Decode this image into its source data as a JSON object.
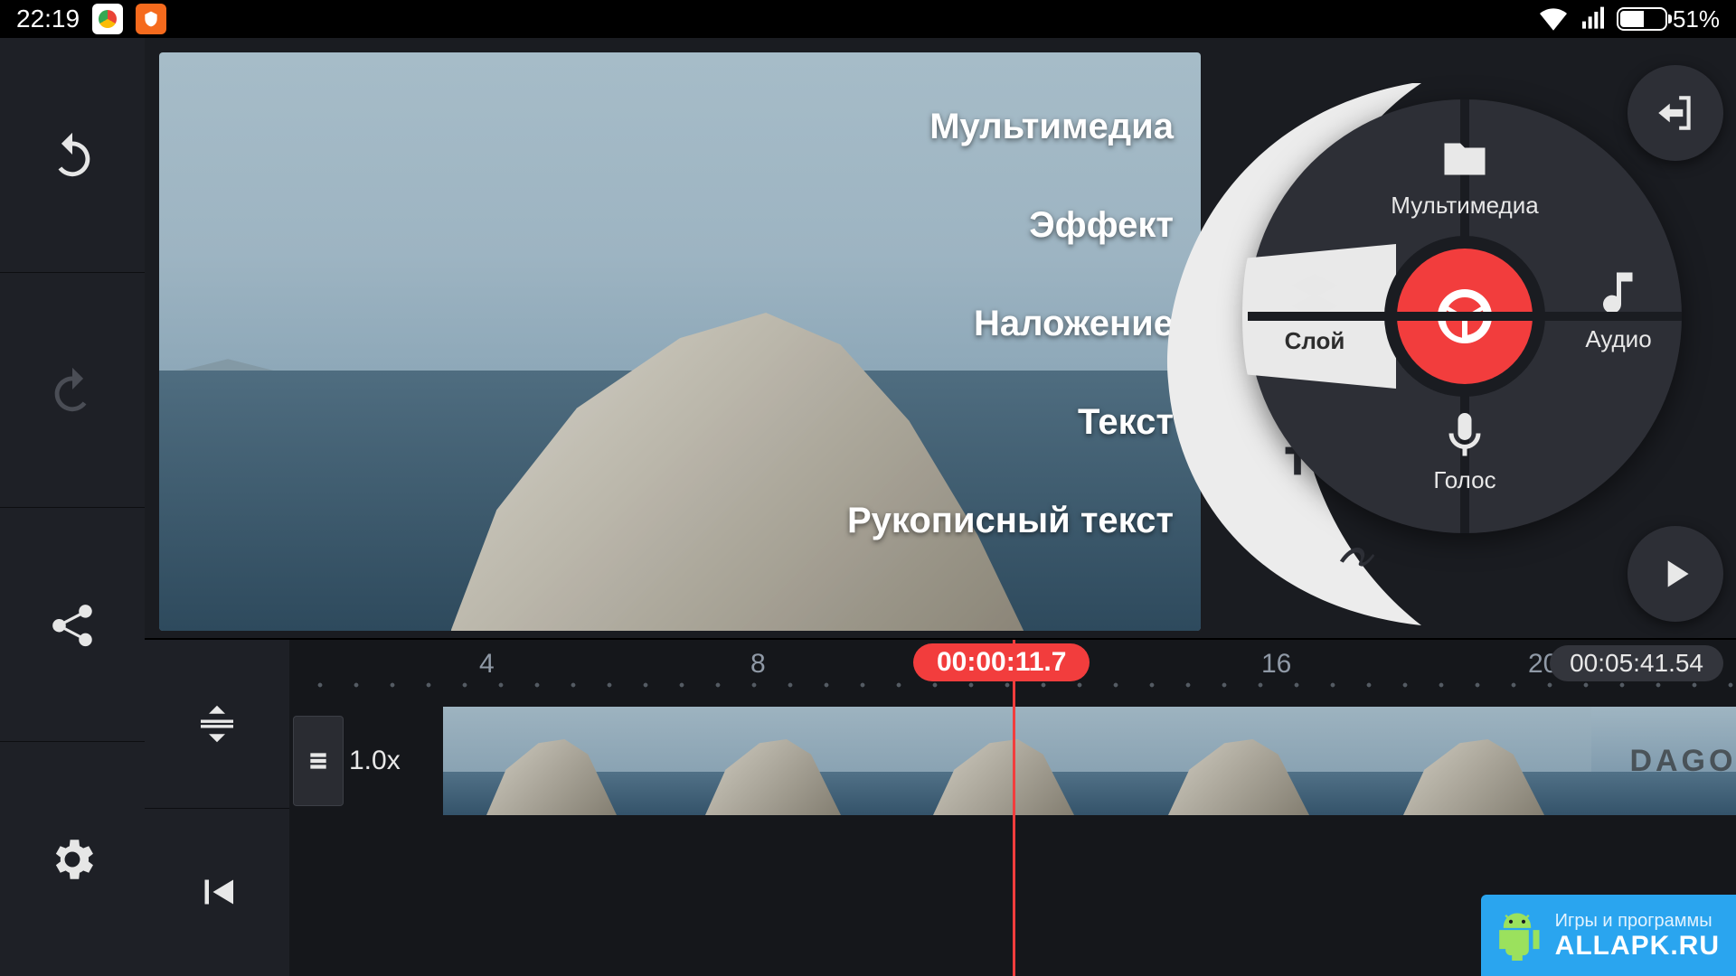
{
  "status": {
    "time": "22:19",
    "battery_pct": "51%"
  },
  "overlay_labels": {
    "multimedia": "Мультимедиа",
    "effect": "Эффект",
    "overlay": "Наложение",
    "text": "Текст",
    "handwriting": "Рукописный текст"
  },
  "dial": {
    "multimedia": "Мультимедиа",
    "layer": "Слой",
    "audio": "Аудио",
    "voice": "Голос"
  },
  "timeline": {
    "speed": "1.0x",
    "ticks": [
      "4",
      "8",
      "16",
      "20"
    ],
    "playhead": "00:00:11.7",
    "total": "00:05:41.54",
    "title_clip_text": "DAGOBA"
  },
  "watermark": {
    "line1": "Игры и программы",
    "line2": "ALLAPK.RU"
  }
}
